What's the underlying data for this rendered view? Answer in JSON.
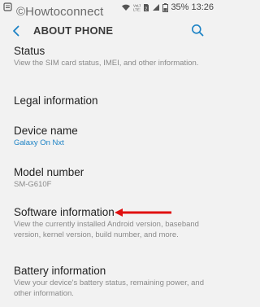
{
  "status_bar": {
    "watermark": "©Howtoconnect",
    "battery": "35%",
    "time": "13:26",
    "icons": [
      "notification-icon",
      "wifi-icon",
      "volte-icon",
      "sim-icon",
      "signal-icon",
      "battery-icon"
    ]
  },
  "app_bar": {
    "title": "ABOUT PHONE",
    "back_icon": "back-chevron-icon",
    "search_icon": "search-icon"
  },
  "items": [
    {
      "title": "Status",
      "subtitle": "View the SIM card status, IMEI, and other information."
    },
    {
      "title": "Legal information",
      "subtitle": ""
    },
    {
      "title": "Device name",
      "subtitle": "Galaxy On Nxt"
    },
    {
      "title": "Model number",
      "subtitle": "SM-G610F"
    },
    {
      "title": "Software information",
      "subtitle": "View the currently installed Android version, baseband version, kernel version, build number, and more."
    },
    {
      "title": "Battery information",
      "subtitle": "View your device's battery status, remaining power, and other information."
    }
  ],
  "colors": {
    "background": "#f2f2f2",
    "accent_link": "#1b82c5",
    "arrow": "#e01010"
  }
}
